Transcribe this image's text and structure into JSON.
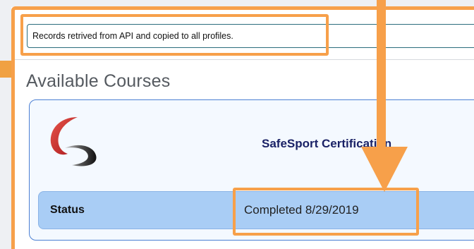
{
  "message": {
    "text": "Records retrived from API and copied to all profiles."
  },
  "section": {
    "title": "Available Courses"
  },
  "course": {
    "logo_icon": "safesport-swoosh-icon",
    "title": "SafeSport Certification",
    "status_label": "Status",
    "status_value": "Completed 8/29/2019"
  },
  "colors": {
    "highlight": "#f7a04a",
    "card_border": "#4b7fd3",
    "status_bg": "#a9cdf5",
    "title_text": "#1a2266"
  }
}
